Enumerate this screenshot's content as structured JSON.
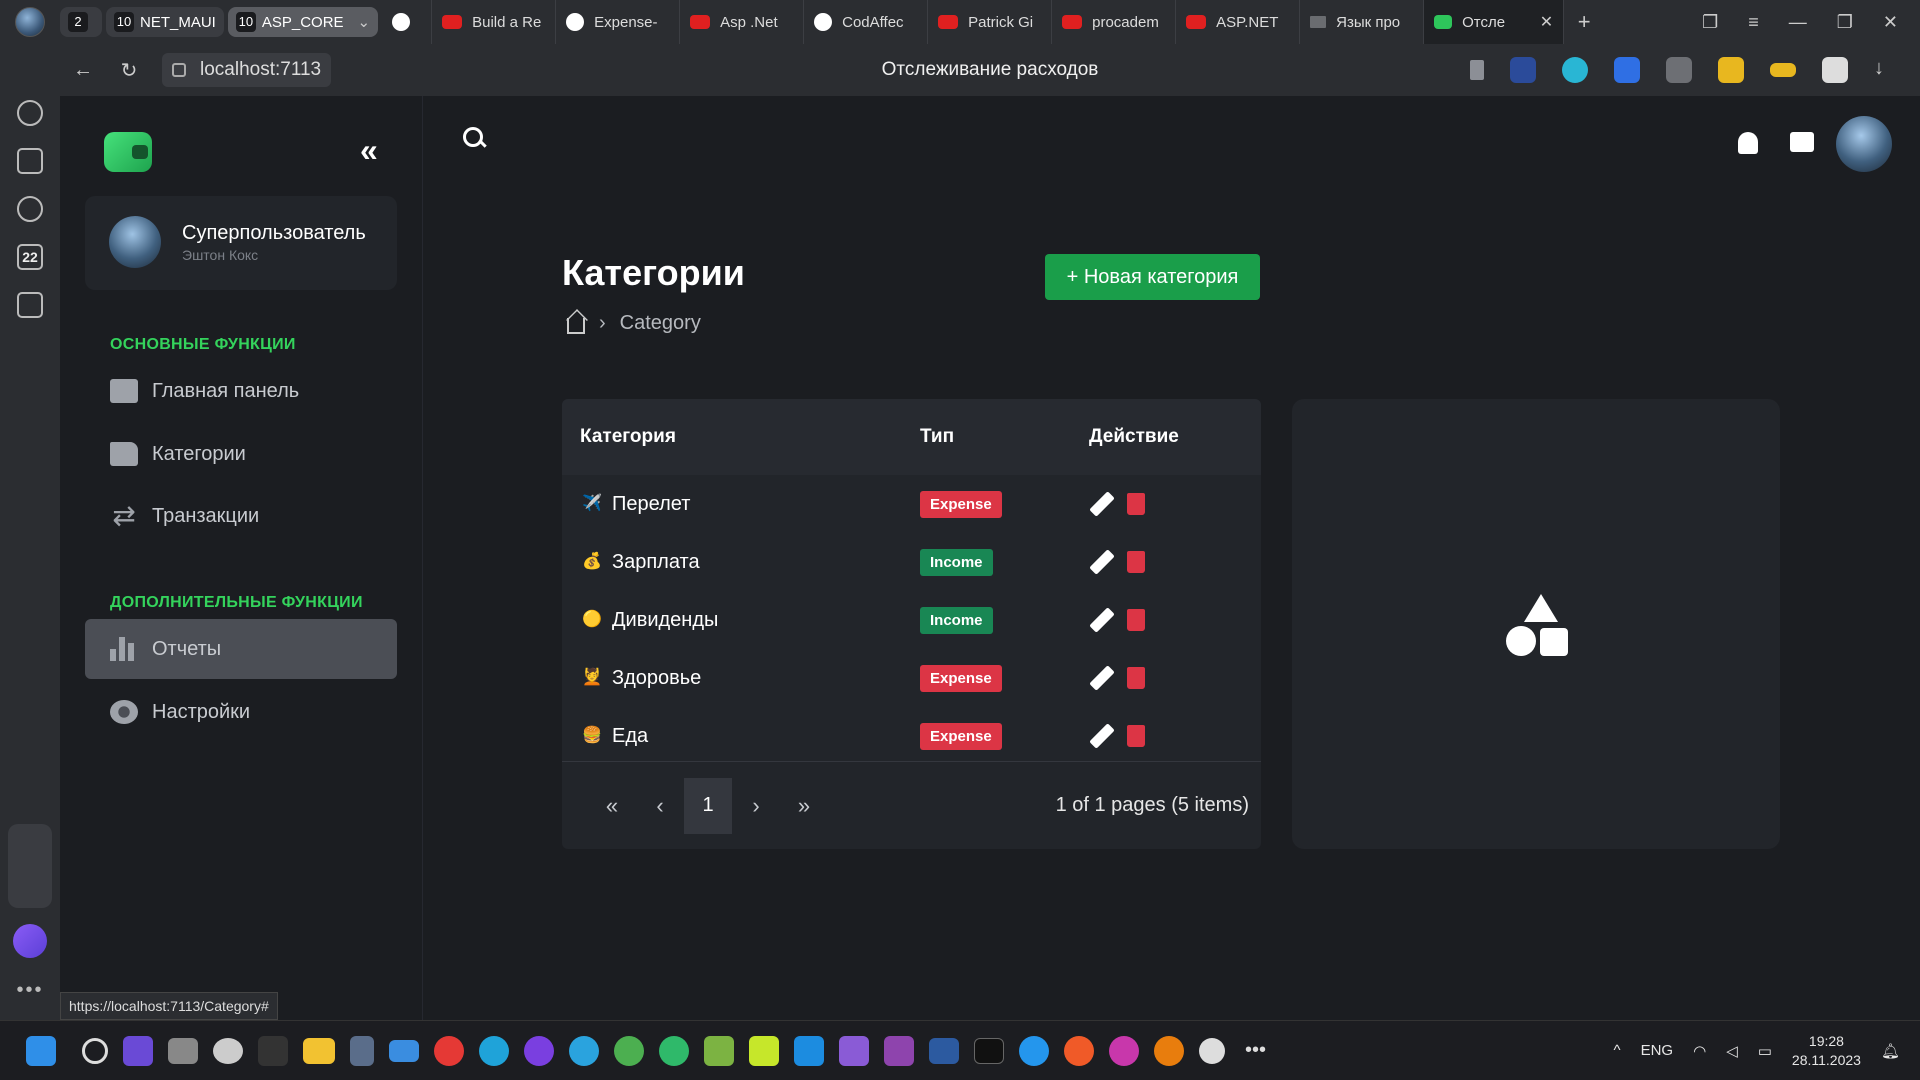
{
  "browser": {
    "tab_groups": [
      {
        "count": "2",
        "label": ""
      },
      {
        "count": "10",
        "label": "NET_MAUI"
      },
      {
        "count": "10",
        "label": "ASP_CORE"
      }
    ],
    "tabs": [
      {
        "label": "",
        "icon": "github-icon"
      },
      {
        "label": "Build a Re",
        "icon": "youtube-icon"
      },
      {
        "label": "Expense-",
        "icon": "github-icon"
      },
      {
        "label": "Asp .Net",
        "icon": "youtube-icon"
      },
      {
        "label": "CodAffec",
        "icon": "github-icon"
      },
      {
        "label": "Patrick Gi",
        "icon": "youtube-icon"
      },
      {
        "label": "procadem",
        "icon": "youtube-icon"
      },
      {
        "label": "ASP.NET",
        "icon": "youtube-icon"
      },
      {
        "label": "Язык про",
        "icon": "mail-icon"
      },
      {
        "label": "Отсле",
        "icon": "wallet-icon"
      }
    ],
    "url": "localhost:7113",
    "page_title": "Отслеживание расходов",
    "status_url": "https://localhost:7113/Category#"
  },
  "sidebar": {
    "user_name": "Суперпользователь",
    "user_sub": "Эштон Кокс",
    "section_main": "ОСНОВНЫЕ ФУНКЦИИ",
    "section_extra": "ДОПОЛНИТЕЛЬНЫЕ ФУНКЦИИ",
    "items": [
      {
        "label": "Главная панель",
        "icon": "dashboard-icon"
      },
      {
        "label": "Категории",
        "icon": "folder-icon"
      },
      {
        "label": "Транзакции",
        "icon": "swap-icon"
      },
      {
        "label": "Отчеты",
        "icon": "chart-icon"
      },
      {
        "label": "Настройки",
        "icon": "gear-icon"
      }
    ]
  },
  "main": {
    "title": "Категории",
    "new_button": "+ Новая категория",
    "breadcrumb": "Category",
    "table": {
      "headers": [
        "Категория",
        "Тип",
        "Действие"
      ],
      "rows": [
        {
          "icon": "✈️",
          "name": "Перелет",
          "type": "Expense"
        },
        {
          "icon": "💰",
          "name": "Зарплата",
          "type": "Income"
        },
        {
          "icon": "🟡",
          "name": "Дивиденды",
          "type": "Income"
        },
        {
          "icon": "💆",
          "name": "Здоровье",
          "type": "Expense"
        },
        {
          "icon": "🍔",
          "name": "Еда",
          "type": "Expense"
        }
      ]
    },
    "pager": {
      "current": "1",
      "first": "«",
      "prev": "‹",
      "next": "›",
      "last": "»",
      "info": "1 of 1 pages (5 items)"
    }
  },
  "taskbar": {
    "lang": "ENG",
    "time": "19:28",
    "date": "28.11.2023"
  },
  "colors": {
    "accent_green": "#1a9e4a",
    "section_green": "#34d35c",
    "expense_red": "#dc3545",
    "income_green": "#198754"
  }
}
